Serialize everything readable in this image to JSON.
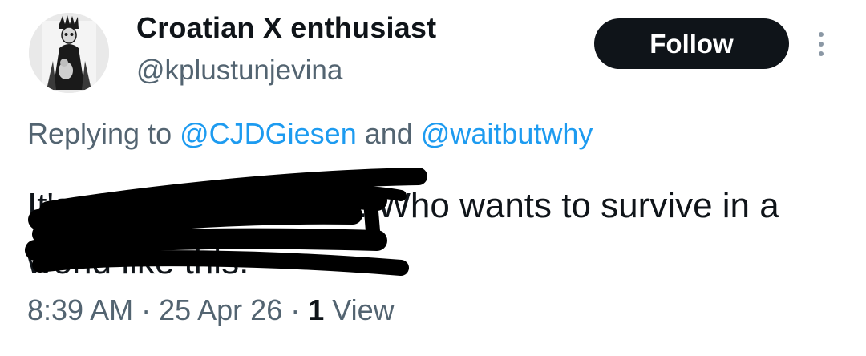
{
  "author": {
    "display_name": "Croatian X enthusiast",
    "handle": "@kplustunjevina"
  },
  "actions": {
    "follow_label": "Follow",
    "more_icon": "more-vertical-icon"
  },
  "reply": {
    "prefix": "Replying to ",
    "mention_1": "@CJDGiesen",
    "joiner": " and ",
    "mention_2": "@waitbutwhy"
  },
  "post": {
    "visible_text": "It's not about survival. Who wants to survive in a world like this."
  },
  "meta": {
    "time": "8:39 AM",
    "separator": " · ",
    "date": "25 Apr 26",
    "views_count": "1",
    "views_label": " View"
  },
  "colors": {
    "text": "#0f1419",
    "secondary": "#536471",
    "link": "#1d9bf0",
    "button_bg": "#0f1419",
    "redaction": "#000000"
  }
}
